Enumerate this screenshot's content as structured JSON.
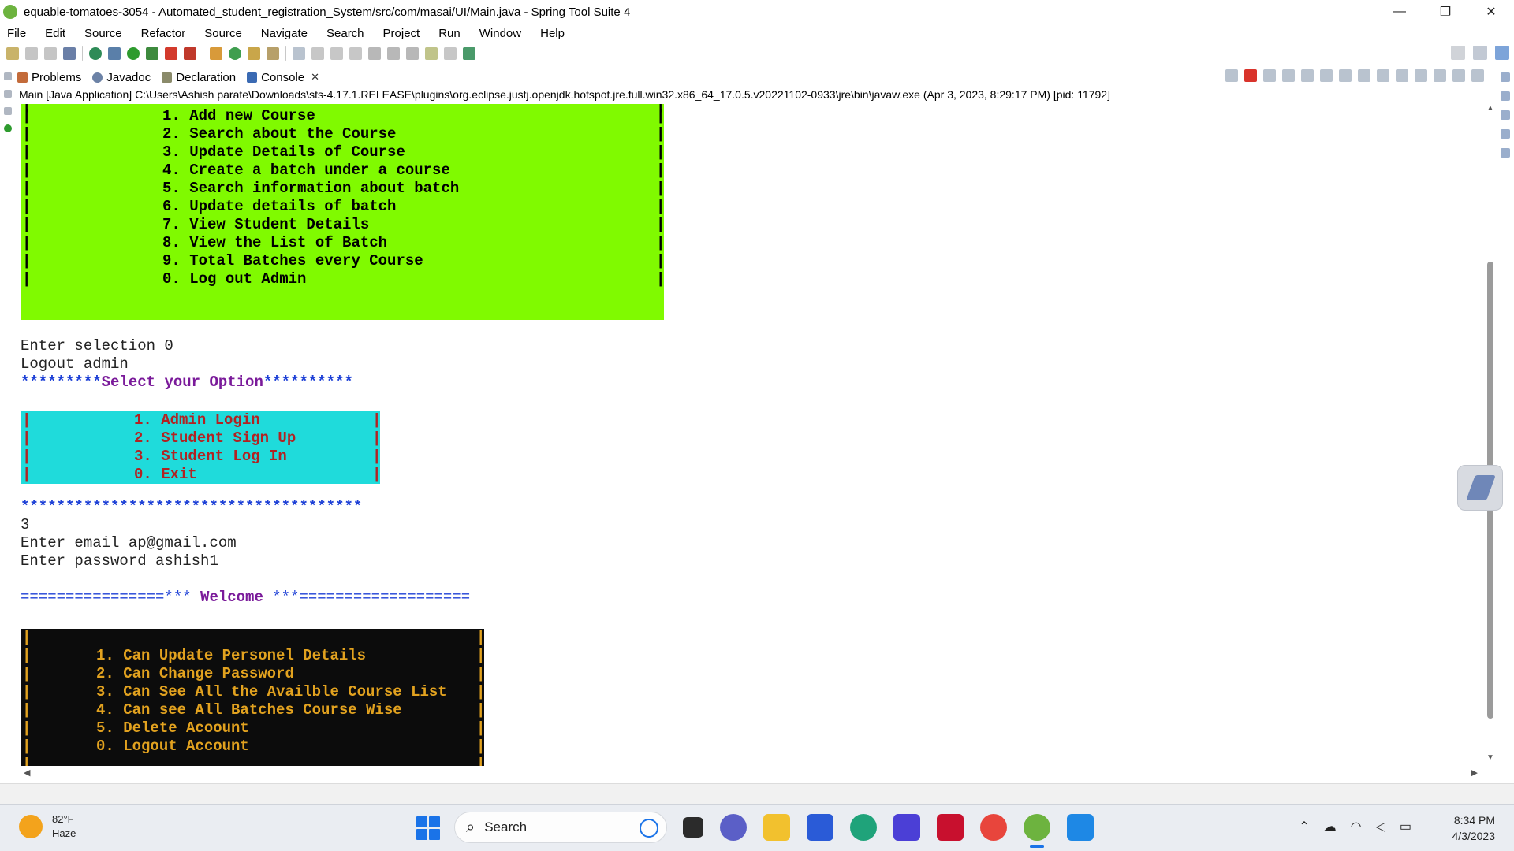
{
  "window": {
    "title": "equable-tomatoes-3054 - Automated_student_registration_System/src/com/masai/UI/Main.java - Spring Tool Suite 4",
    "minimize": "—",
    "restore": "❐",
    "close": "✕"
  },
  "menu": [
    "File",
    "Edit",
    "Source",
    "Refactor",
    "Source",
    "Navigate",
    "Search",
    "Project",
    "Run",
    "Window",
    "Help"
  ],
  "tabs": [
    {
      "label": "Problems",
      "icon": "problems-icon"
    },
    {
      "label": "Javadoc",
      "icon": "javadoc-icon"
    },
    {
      "label": "Declaration",
      "icon": "declaration-icon"
    },
    {
      "label": "Console",
      "icon": "console-icon",
      "active": true
    }
  ],
  "launch_info": "Main [Java Application] C:\\Users\\Ashish parate\\Downloads\\sts-4.17.1.RELEASE\\plugins\\org.eclipse.justj.openjdk.hotspot.jre.full.win32.x86_64_17.0.5.v20221102-0933\\jre\\bin\\javaw.exe  (Apr 3, 2023, 8:29:17 PM) [pid: 11792]",
  "console": {
    "admin_menu": [
      "1. Add new Course",
      "2. Search about the Course",
      "3. Update Details of Course",
      "4. Create a batch under a course",
      "5. Search information about batch",
      "6. Update details of batch",
      "7. View Student Details",
      "8. View the List of Batch",
      "9. Total Batches every Course",
      "0. Log out Admin"
    ],
    "enter_selection": "Enter selection 0",
    "logout_admin": "Logout admin",
    "select_stars_left": "*********",
    "select_title": "Select your Option",
    "select_stars_right": "**********",
    "main_menu": [
      "1. Admin Login",
      "2. Student Sign Up",
      "3. Student Log In",
      "0. Exit"
    ],
    "stars_line": "**************************************",
    "input_value": "3",
    "enter_email": "Enter email ap@gmail.com",
    "enter_password": "Enter password ashish1",
    "welcome_left": "================***",
    "welcome_title": " Welcome ",
    "welcome_right": "***===================",
    "student_menu": [
      "1. Can Update Personel Details",
      "2. Can Change Password",
      "3. Can See All the Availble Course List",
      "4. Can see All Batches Course Wise",
      "5. Delete Acoount",
      "0. Logout Account"
    ]
  },
  "taskbar": {
    "temperature": "82°F",
    "weather": "Haze",
    "search_placeholder": "Search",
    "time": "8:34 PM",
    "date": "4/3/2023"
  },
  "colors": {
    "admin_menu_bg": "#80fa00",
    "main_menu_bg": "#1fdbdb",
    "main_menu_text": "#b22222",
    "student_menu_bg": "#0c0c0c",
    "student_menu_text": "#e2a21f",
    "stars": "#1c3fd6",
    "heading": "#7a1a9a"
  }
}
